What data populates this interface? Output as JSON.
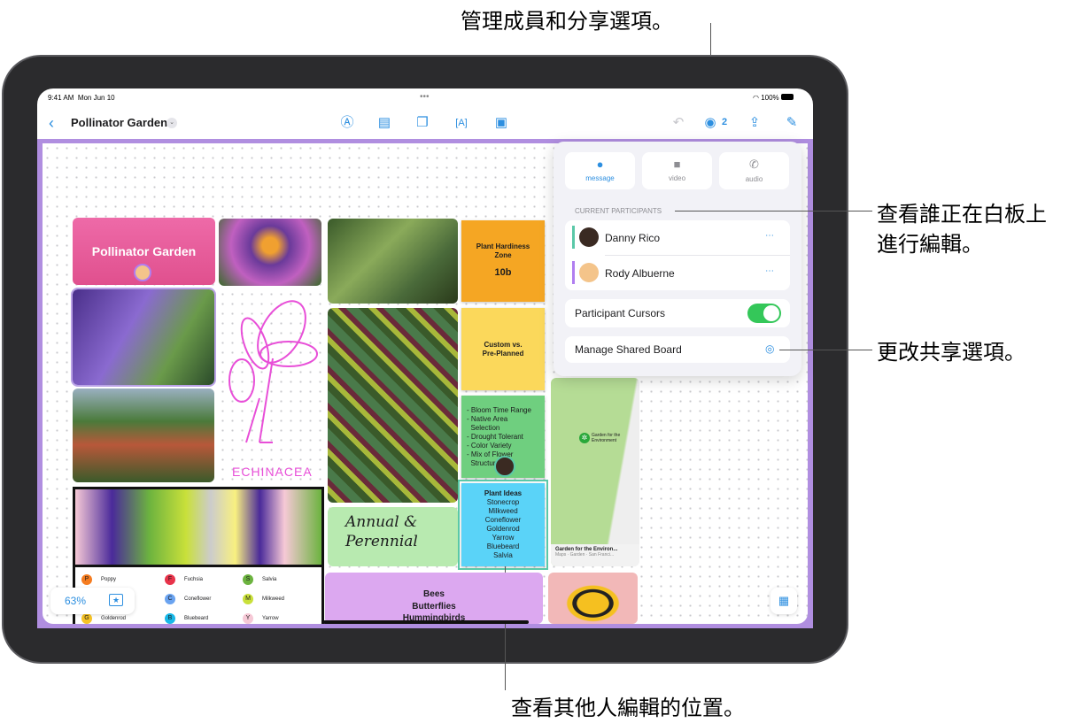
{
  "annotations": {
    "top": "管理成員和分享選項。",
    "right1_line1": "查看誰正在白板上",
    "right1_line2": "進行編輯。",
    "right2": "更改共享選項。",
    "bottom": "查看其他人編輯的位置。"
  },
  "status_bar": {
    "time": "9:41 AM",
    "date": "Mon Jun 10",
    "battery": "100%"
  },
  "toolbar": {
    "title": "Pollinator Garden",
    "participant_count": "2",
    "icons": [
      "back-chevron",
      "title-dropdown",
      "pen-icon",
      "note-icon",
      "shapes-icon",
      "text-box-icon",
      "media-icon",
      "undo-icon",
      "collaborate-icon",
      "share-icon",
      "compose-icon"
    ]
  },
  "popover": {
    "buttons": [
      {
        "label": "message",
        "icon": "message-icon"
      },
      {
        "label": "video",
        "icon": "video-icon"
      },
      {
        "label": "audio",
        "icon": "phone-icon"
      }
    ],
    "section_label": "CURRENT PARTICIPANTS",
    "participants": [
      {
        "name": "Danny Rico",
        "color": "#5ac8a8"
      },
      {
        "name": "Rody Albuerne",
        "color": "#b07ef0"
      }
    ],
    "cursors_label": "Participant Cursors",
    "cursors_on": true,
    "manage_label": "Manage Shared Board"
  },
  "board": {
    "title_card": "Pollinator Garden",
    "echinacea_label": "ECHINACEA",
    "handwritten": "Annual & Perennial",
    "stickies": [
      {
        "lines": [
          "Plant Hardiness",
          "Zone",
          "",
          "10b"
        ],
        "color": "#f5a623"
      },
      {
        "lines": [
          "Custom vs.",
          "Pre-Planned"
        ],
        "color": "#fbd85b"
      },
      {
        "lines": [
          "- Bloom Time Range",
          "- Native Area",
          "  Selection",
          "- Drought Tolerant",
          "- Color Variety",
          "- Mix of Flower",
          "  Structure"
        ],
        "color": "#6fcf7f"
      },
      {
        "lines": [
          "Plant Ideas",
          "Stonecrop",
          "Milkweed",
          "Coneflower",
          "Goldenrod",
          "Yarrow",
          "Bluebeard",
          "Salvia"
        ],
        "color": "#5ad3f8"
      }
    ],
    "map": {
      "pin_label": "Garden for the Environment",
      "title": "Garden for the Environ...",
      "subtitle": "Maps · Garden · San Franci..."
    },
    "bees_card": [
      "Bees",
      "Butterflies",
      "Hummingbirds"
    ],
    "legend": [
      {
        "letter": "P",
        "name": "Poppy",
        "color": "#f57c1f"
      },
      {
        "letter": "F",
        "name": "Fuchsia",
        "color": "#e8334a"
      },
      {
        "letter": "S",
        "name": "Salvia",
        "color": "#6cb33f"
      },
      {
        "letter": "C",
        "name": "Coneflower",
        "color": "#6aa3f0"
      },
      {
        "letter": "M",
        "name": "Milkweed",
        "color": "#c9e03a"
      },
      {
        "letter": "G",
        "name": "Goldenrod",
        "color": "#f7c325"
      },
      {
        "letter": "B",
        "name": "Bluebeard",
        "color": "#18b8e8"
      },
      {
        "letter": "Y",
        "name": "Yarrow",
        "color": "#f6c9d6"
      }
    ],
    "zoom_level": "63%"
  }
}
